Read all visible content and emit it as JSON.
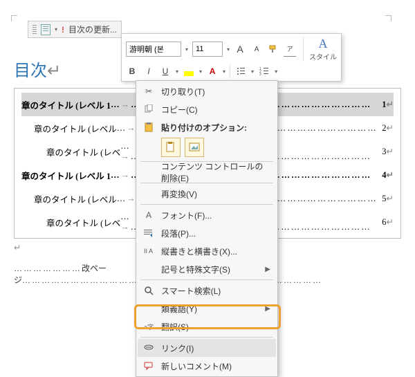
{
  "topbar": {
    "update_label": "目次の更新..."
  },
  "ribbon": {
    "font_name": "游明朝 (본",
    "font_size": "11",
    "grow": "A",
    "shrink": "A",
    "style_label": "スタイル",
    "bold": "B",
    "italic": "I",
    "underline": "U",
    "phonetic": "ア"
  },
  "doc": {
    "title": "目次",
    "toc": [
      {
        "level": 1,
        "text": "章のタイトル (レベル 1",
        "page": "1",
        "sel": true
      },
      {
        "level": 2,
        "text": "章のタイトル (レベル",
        "page": "2"
      },
      {
        "level": 3,
        "text": "章のタイトル (レベ",
        "page": "3"
      },
      {
        "level": 1,
        "text": "章のタイトル (レベル 1",
        "page": "4"
      },
      {
        "level": 2,
        "text": "章のタイトル (レベル",
        "page": "5"
      },
      {
        "level": 3,
        "text": "章のタイトル (レベ",
        "page": "6"
      }
    ],
    "pagebreak": "改ページ"
  },
  "ctx": {
    "cut": "切り取り(T)",
    "copy": "コピー(C)",
    "paste_header": "貼り付けのオプション:",
    "del_cc": "コンテンツ コントロールの削除(E)",
    "reconvert": "再変換(V)",
    "font": "フォント(F)...",
    "para": "段落(P)...",
    "vert": "縦書きと横書き(X)...",
    "symbol": "記号と特殊文字(S)",
    "smart": "スマート検索(L)",
    "syn": "類義語(Y)",
    "trans": "翻訳(S)",
    "link": "リンク(I)",
    "comment": "新しいコメント(M)"
  }
}
